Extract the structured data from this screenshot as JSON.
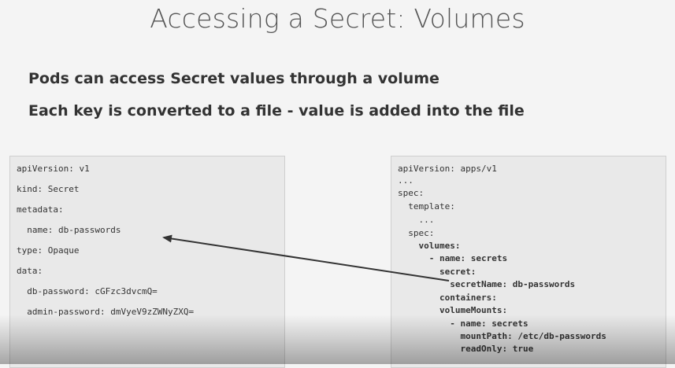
{
  "slide": {
    "title": "Accessing a Secret: Volumes",
    "bullets": [
      "Pods can access Secret values through a volume",
      "Each key is converted to a file - value is added into the file"
    ]
  },
  "left_code": {
    "lines": [
      "apiVersion: v1",
      "kind: Secret",
      "metadata:",
      "  name: db-passwords",
      "type: Opaque",
      "data:",
      "  db-password: cGFzc3dvcmQ=",
      "  admin-password: dmVyeV9zZWNyZXQ="
    ]
  },
  "right_code": {
    "lines": [
      "apiVersion: apps/v1",
      "...",
      "spec:",
      "  template:",
      "    ...",
      "  spec:",
      "    volumes:",
      "      - name: secrets",
      "        secret:",
      "          secretName: db-passwords",
      "        containers:",
      "        volumeMounts:",
      "          - name: secrets",
      "            mountPath: /etc/db-passwords",
      "            readOnly: true"
    ]
  },
  "colors": {
    "arrow": "#333333",
    "code_background": "#e9e9e9",
    "page_background": "#f4f4f4"
  }
}
